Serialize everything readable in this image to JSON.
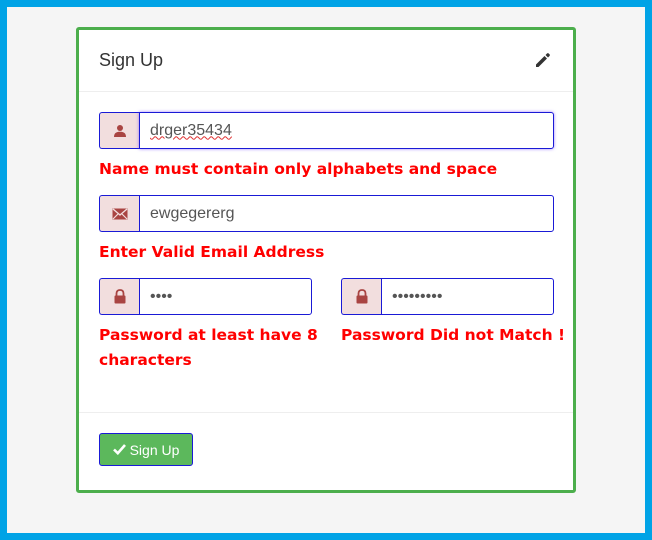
{
  "form": {
    "title": "Sign Up",
    "icons": {
      "edit": "pencil-icon",
      "name": "user-icon",
      "email": "envelope-icon",
      "password": "lock-icon",
      "confirm": "lock-icon",
      "submit": "checkmark-icon"
    },
    "name_value": "drger35434",
    "name_error": "Name must contain only alphabets and space",
    "email_value": "ewgegererg",
    "email_error": "Enter Valid Email Address",
    "password_value": "••••",
    "password_error": "Password at least have 8 characters",
    "confirm_value": "•••••••••",
    "confirm_error": "Password Did not Match !",
    "submit_label": "Sign Up"
  },
  "colors": {
    "accent_border": "#1a1ad6",
    "panel_border": "#4cae4c",
    "error": "#ff0000",
    "button": "#5cb85c",
    "addon_bg": "#f2dede",
    "icon": "#a94442",
    "window_border": "#00a3e6"
  }
}
